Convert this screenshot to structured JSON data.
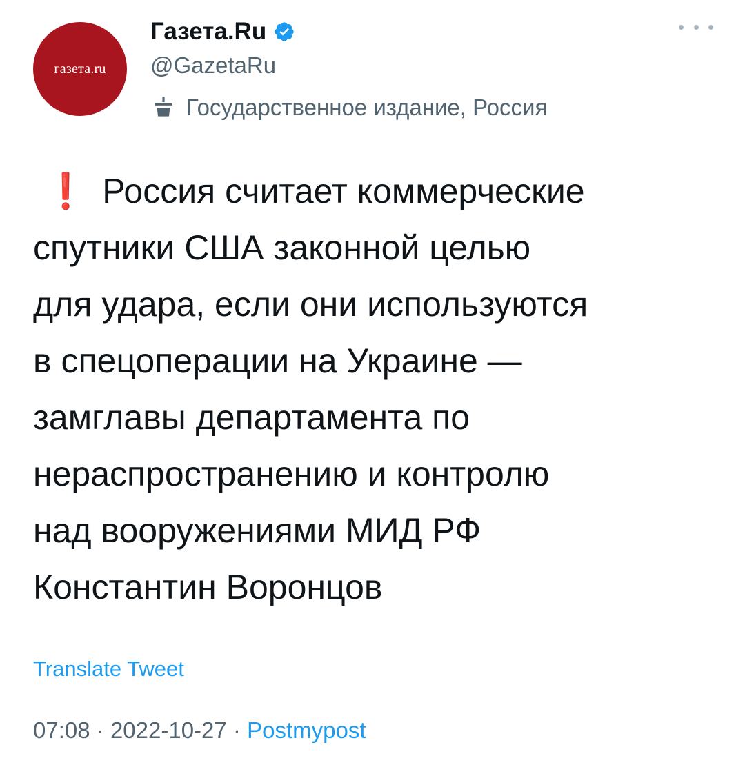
{
  "author": {
    "avatar_text": "газета.ru",
    "display_name": "Газета.Ru",
    "handle": "@GazetaRu",
    "label": "Государственное издание, Россия",
    "verified_icon": "verified-badge-icon",
    "label_icon": "state-media-podium-icon"
  },
  "tweet": {
    "emoji": "❗",
    "lines": [
      "Россия считает коммерческие",
      "спутники США законной целью",
      "для удара, если они используются",
      "в спецоперации на Украине —",
      "замглавы департамента по",
      "нераспространению и контролю",
      "над вооружениями МИД РФ",
      "Константин Воронцов"
    ],
    "translate_label": "Translate Tweet"
  },
  "meta": {
    "time": "07:08",
    "separator": "·",
    "date": "2022-10-27",
    "source": "Postmypost"
  },
  "colors": {
    "brand_red": "#a8151e",
    "verified_blue": "#1d9bf0",
    "link_blue": "#1d9bf0",
    "secondary_text": "#536471",
    "alert_red": "#e0252d"
  }
}
